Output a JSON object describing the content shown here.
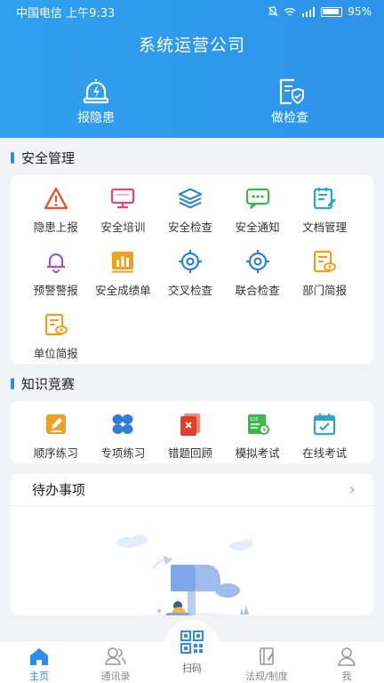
{
  "status_bar": {
    "carrier": "中国电信 上午9:33",
    "battery": "95%"
  },
  "header": {
    "title": "系统运营公司",
    "actions": [
      {
        "label": "报隐患"
      },
      {
        "label": "做检查"
      }
    ]
  },
  "safety": {
    "title": "安全管理",
    "items": [
      {
        "label": "隐患上报",
        "icon": "warning-triangle-icon",
        "color": "#e05a3a"
      },
      {
        "label": "安全培训",
        "icon": "monitor-icon",
        "color": "#e0457b"
      },
      {
        "label": "安全检查",
        "icon": "layers-icon",
        "color": "#2f7fd8"
      },
      {
        "label": "安全通知",
        "icon": "chat-bubble-icon",
        "color": "#3cb84a"
      },
      {
        "label": "文档管理",
        "icon": "document-edit-icon",
        "color": "#27a8c5"
      },
      {
        "label": "预警警报",
        "icon": "bell-icon",
        "color": "#a84fd6"
      },
      {
        "label": "安全成绩单",
        "icon": "bar-chart-icon",
        "color": "#f0a020"
      },
      {
        "label": "交叉检查",
        "icon": "target-icon",
        "color": "#2f7fd8"
      },
      {
        "label": "联合检查",
        "icon": "target-icon",
        "color": "#2f7fd8"
      },
      {
        "label": "部门简报",
        "icon": "report-eye-icon",
        "color": "#f0a020"
      },
      {
        "label": "单位简报",
        "icon": "report-eye-icon",
        "color": "#f0a020"
      }
    ]
  },
  "contest": {
    "title": "知识竞赛",
    "items": [
      {
        "label": "顺序练习",
        "icon": "pencil-square-icon",
        "color": "#f0a020"
      },
      {
        "label": "专项练习",
        "icon": "four-petal-icon",
        "color": "#2f7fd8"
      },
      {
        "label": "错题回顾",
        "icon": "error-book-icon",
        "color": "#e0402a"
      },
      {
        "label": "模拟考试",
        "icon": "exam-sheet-icon",
        "color": "#3cb84a"
      },
      {
        "label": "在线考试",
        "icon": "calendar-check-icon",
        "color": "#27a8c5"
      }
    ]
  },
  "todo": {
    "title": "待办事项",
    "chevron": "›"
  },
  "tabbar": {
    "tabs": [
      {
        "label": "主页",
        "icon": "home-icon",
        "active": true
      },
      {
        "label": "通讯录",
        "icon": "contacts-icon",
        "active": false
      },
      {
        "label": "扫码",
        "icon": "qr-code-icon",
        "active": false
      },
      {
        "label": "法规/制度",
        "icon": "regulation-icon",
        "active": false
      },
      {
        "label": "我",
        "icon": "user-icon",
        "active": false
      }
    ]
  },
  "colors": {
    "primary": "#2d8cf0",
    "header": "#2e9aec"
  }
}
